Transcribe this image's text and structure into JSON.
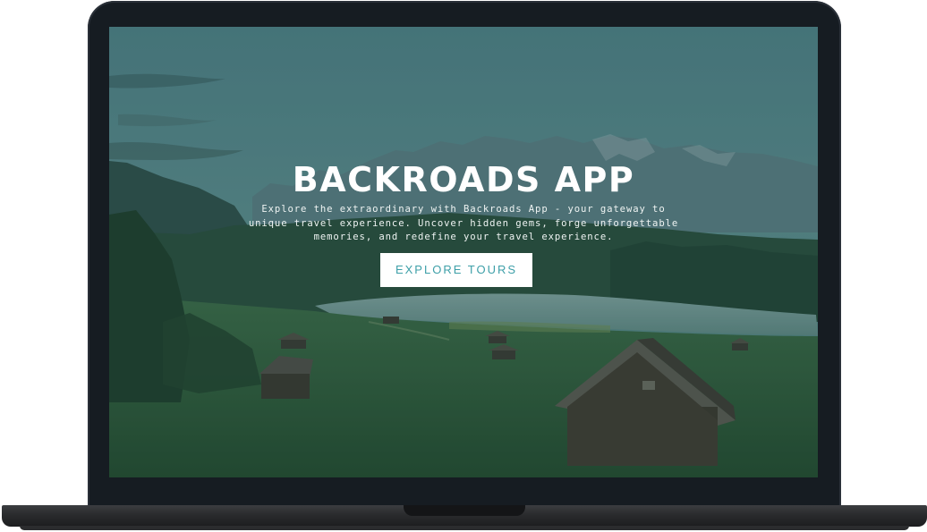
{
  "hero": {
    "title": "BACKROADS APP",
    "description": "Explore the extraordinary with Backroads App - your gateway to unique travel experience. Uncover hidden gems, forge unforgettable memories, and redefine your travel experience.",
    "button_label": "EXPLORE TOURS"
  },
  "colors": {
    "button_text": "#3d9fa8",
    "button_bg": "#ffffff",
    "title_text": "#ffffff",
    "laptop_bezel": "#161c22"
  },
  "icons": {
    "background": "mountain-lake-landscape-photo"
  }
}
